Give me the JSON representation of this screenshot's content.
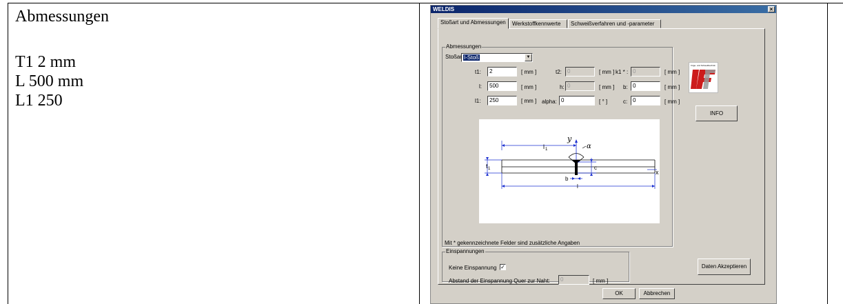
{
  "document": {
    "left_lines": [
      "Abmessungen",
      "",
      "T1 2 mm",
      "L 500 mm",
      "L1 250"
    ]
  },
  "window": {
    "title": "WELDIS",
    "close_glyph": "×",
    "tabs": [
      {
        "label": "Stoßart und Abmessungen",
        "active": true
      },
      {
        "label": "Werkstoffkennwerte",
        "active": false
      },
      {
        "label": "Schweißverfahren und -parameter",
        "active": false
      }
    ],
    "dimensions": {
      "group_label": "Abmessungen",
      "joint_label": "Stoßart:",
      "joint_value": "I-Stoß",
      "t1": {
        "label": "t1:",
        "value": "2",
        "unit": "[ mm ]"
      },
      "t2": {
        "label": "t2:",
        "value": "0",
        "unit": "[ mm ]"
      },
      "k1": {
        "label": "k1 * :",
        "value": "0",
        "unit": "[ mm ]"
      },
      "l": {
        "label": "l:",
        "value": "500",
        "unit": "[ mm ]"
      },
      "h": {
        "label": "h:",
        "value": "0",
        "unit": "[ mm ]"
      },
      "b": {
        "label": "b:",
        "value": "0",
        "unit": "[ mm ]"
      },
      "l1": {
        "label": "l1:",
        "value": "250",
        "unit": "[ mm ]"
      },
      "alpha": {
        "label": "alpha:",
        "value": "0",
        "unit": "[ ° ]"
      },
      "c": {
        "label": "c:",
        "value": "0",
        "unit": "[ mm ]"
      },
      "note": "Mit * gekennzeichnete Felder sind zusätzliche Angaben"
    },
    "diagram": {
      "y": "y",
      "alpha": "α",
      "l1": "l",
      "l1_sub": "1",
      "t1": "t",
      "t1_sub": "1",
      "c": "c",
      "b": "b",
      "l": "l",
      "x": "x"
    },
    "logo": {
      "caption": "Füge- und Schweißtechnik",
      "letters": "LFT"
    },
    "info_button": "INFO",
    "clamping": {
      "group_label": "Einspannungen",
      "none_label": "Keine Einspannung",
      "none_checked": "✓",
      "distance_label": "Abstand der Einspannung Quer zur Naht:",
      "distance_value": "0",
      "distance_unit": "[ mm ]"
    },
    "accept_button": "Daten Akzeptieren",
    "ok_button": "OK",
    "cancel_button": "Abbrechen"
  }
}
